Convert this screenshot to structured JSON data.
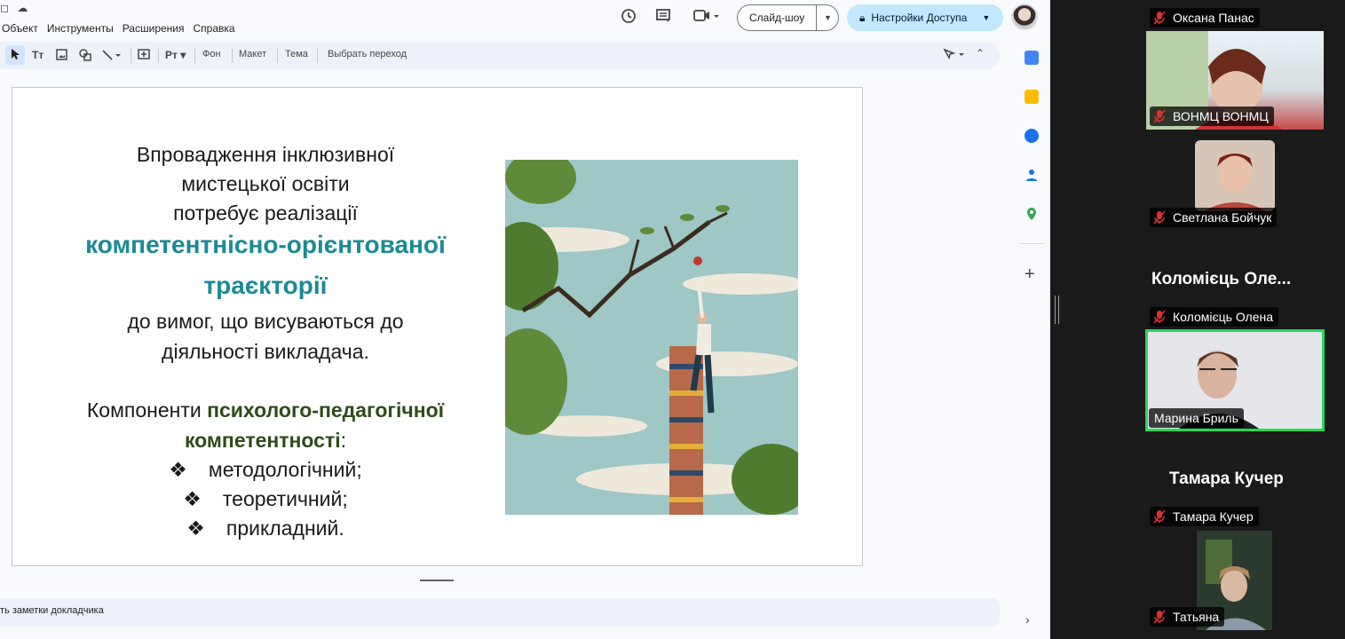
{
  "menubar": {
    "items": [
      "Объект",
      "Инструменты",
      "Расширения",
      "Справка"
    ]
  },
  "toolbar": {
    "fon": "Фон",
    "maket": "Макет",
    "tema": "Тема",
    "transition": "Выбрать переход"
  },
  "header": {
    "slideshow_label": "Слайд-шоу",
    "share_label": "Настройки Доступа"
  },
  "slide": {
    "line1": "Впровадження інклюзивної",
    "line2": "мистецької освіти",
    "line3": "потребує реалізації",
    "line4": "компетентнісно-орієнтованої",
    "line5": "траєкторії",
    "line6": "до вимог, що висуваються до",
    "line7": "діяльності викладача.",
    "components_prefix": "Компоненти ",
    "components_highlight_a": "психолого-педагогічної",
    "components_highlight_b": "компетентності",
    "components_suffix": ":",
    "bullets": [
      "методологічний;",
      "теоретичний;",
      "прикладний."
    ]
  },
  "notes": {
    "placeholder": "ть заметки докладчика"
  },
  "participants": {
    "oksana": "Оксана Панас",
    "vonmc": "ВОНМЦ ВОНМЦ",
    "svetlana": "Светлана Бойчук",
    "kolomiets_big": "Коломієць Оле...",
    "kolomiets": "Коломієць Олена",
    "maryna": "Марина Бриль",
    "tamara_big": "Тамара Кучер",
    "tamara": "Тамара Кучер",
    "tatiana": "Татьяна"
  },
  "colors": {
    "teal": "#1b8a96",
    "dark_green": "#2f4b19",
    "active_speaker_border": "#23d959",
    "mic_muted": "#e02f2f"
  }
}
